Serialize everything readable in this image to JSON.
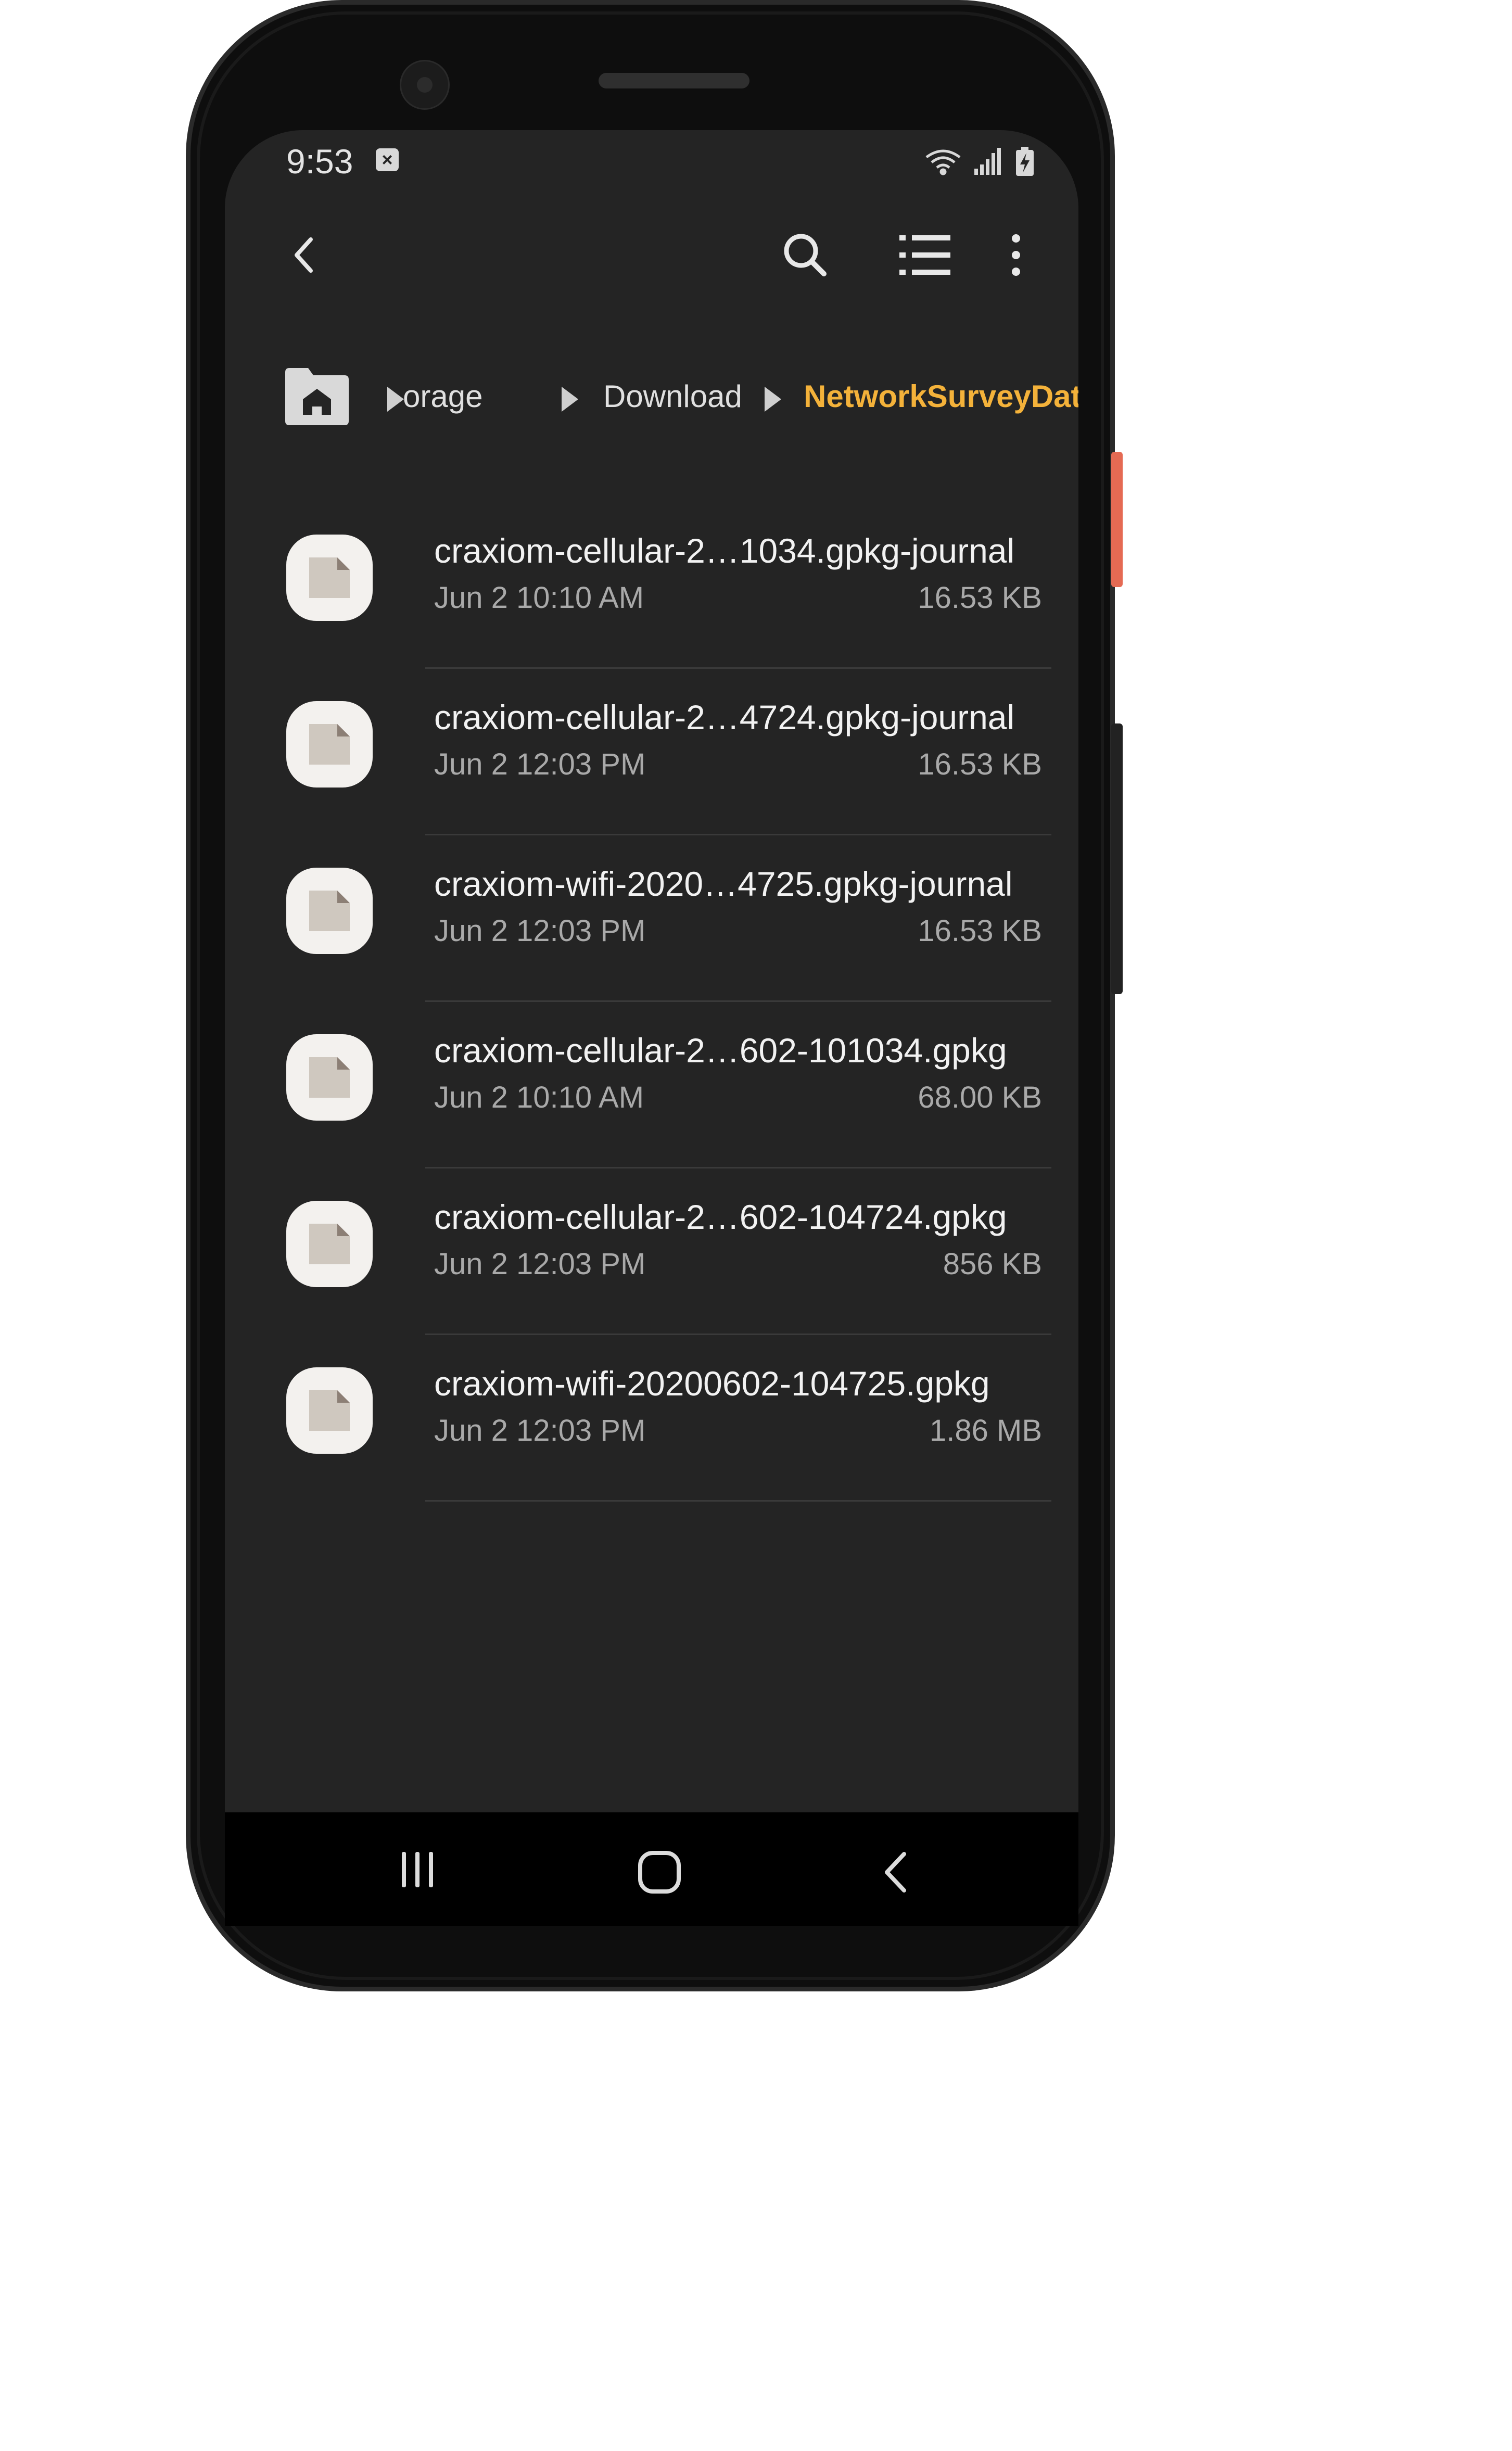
{
  "status_bar": {
    "time": "9:53",
    "notification_icon": "x-box-icon",
    "icons": [
      "wifi-icon",
      "signal-icon",
      "battery-charging-icon"
    ]
  },
  "toolbar": {
    "back_icon": "back-arrow-icon",
    "search_icon": "search-icon",
    "list_view_icon": "list-view-icon",
    "more_icon": "more-vertical-icon"
  },
  "breadcrumb": {
    "home_icon": "home-folder-icon",
    "items": [
      {
        "label": "orage"
      },
      {
        "label": "Download"
      },
      {
        "label": "NetworkSurveyData"
      }
    ]
  },
  "files": [
    {
      "name": "craxiom-cellular-2…1034.gpkg-journal",
      "date": "Jun 2 10:10 AM",
      "size": "16.53 KB"
    },
    {
      "name": "craxiom-cellular-2…4724.gpkg-journal",
      "date": "Jun 2 12:03 PM",
      "size": "16.53 KB"
    },
    {
      "name": "craxiom-wifi-2020…4725.gpkg-journal",
      "date": "Jun 2 12:03 PM",
      "size": "16.53 KB"
    },
    {
      "name": "craxiom-cellular-2…602-101034.gpkg",
      "date": "Jun 2 10:10 AM",
      "size": "68.00 KB"
    },
    {
      "name": "craxiom-cellular-2…602-104724.gpkg",
      "date": "Jun 2 12:03 PM",
      "size": "856 KB"
    },
    {
      "name": "craxiom-wifi-20200602-104725.gpkg",
      "date": "Jun 2 12:03 PM",
      "size": "1.86 MB"
    }
  ],
  "nav_bar": {
    "recents_icon": "recents-icon",
    "home_icon": "home-button-icon",
    "back_icon": "nav-back-icon"
  },
  "colors": {
    "background": "#242424",
    "accent": "#f4b23a",
    "text_primary": "#f2f2f2",
    "text_secondary": "#a9a9a9",
    "side_button": "#e56a53"
  }
}
